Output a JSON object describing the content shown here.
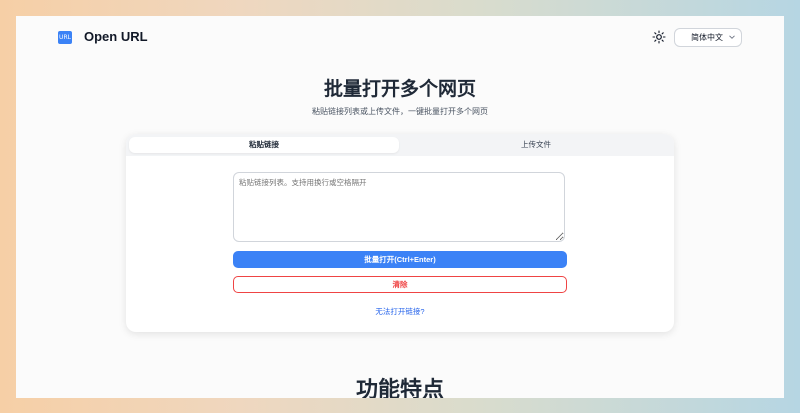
{
  "header": {
    "logo_text": "URL",
    "brand": "Open URL",
    "theme_icon": "sun-icon",
    "language_select": {
      "value": "简体中文",
      "icon": "chevron-down-icon"
    }
  },
  "hero": {
    "title": "批量打开多个网页",
    "subtitle": "粘贴链接列表或上传文件，一键批量打开多个网页"
  },
  "card": {
    "tabs": [
      {
        "label": "粘贴链接",
        "active": true
      },
      {
        "label": "上传文件",
        "active": false
      }
    ],
    "textarea": {
      "placeholder": "粘贴链接列表。支持用换行或空格隔开",
      "value": ""
    },
    "open_button": "批量打开(Ctrl+Enter)",
    "clear_button": "清除",
    "help_link": "无法打开链接?"
  },
  "features": {
    "title": "功能特点"
  },
  "colors": {
    "accent": "#3b82f6",
    "danger": "#ef4444",
    "link": "#2563eb"
  }
}
